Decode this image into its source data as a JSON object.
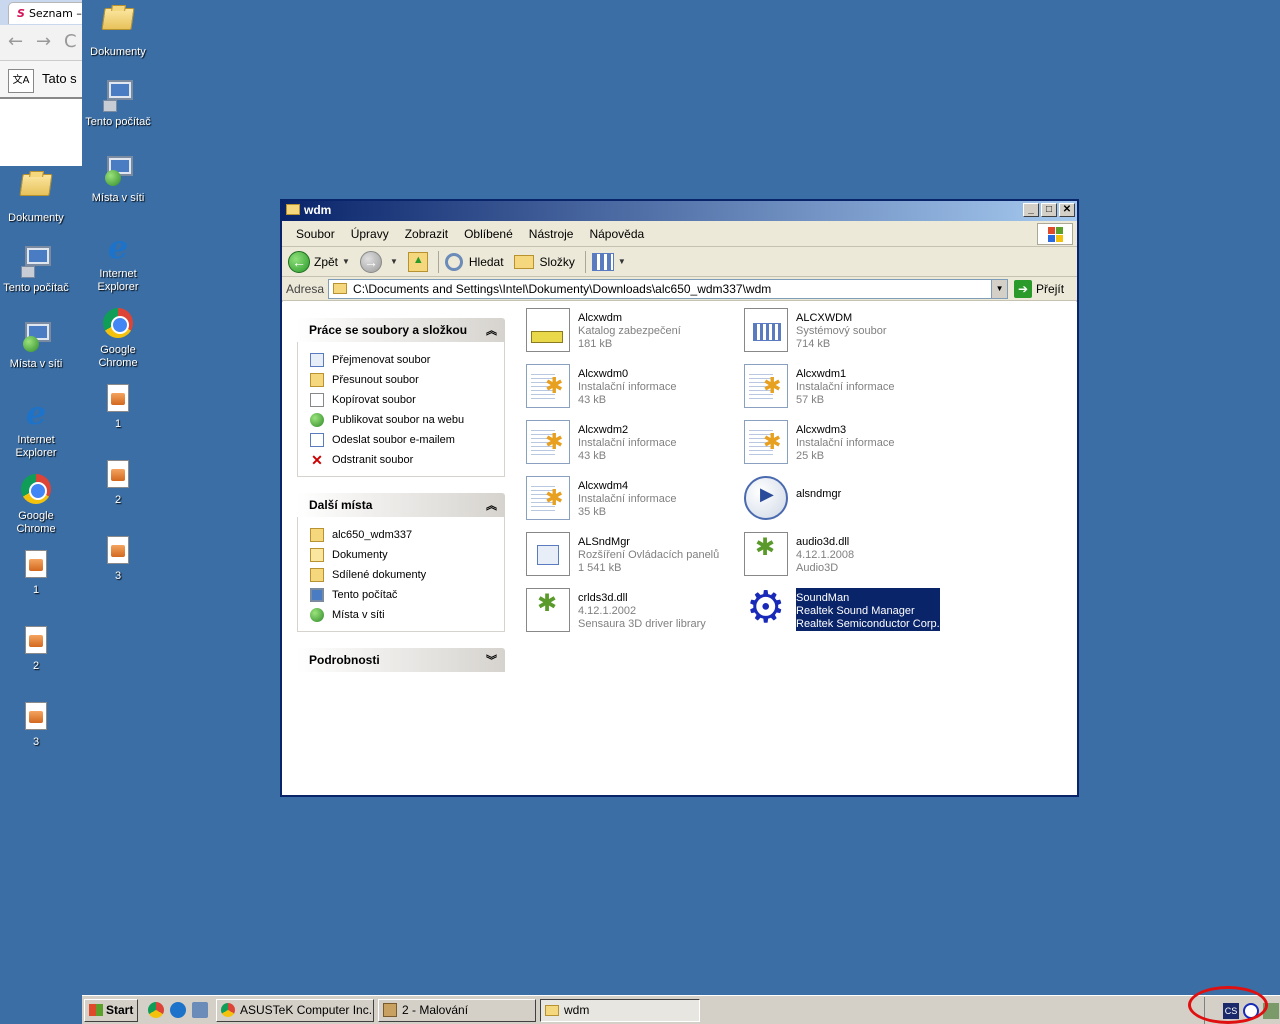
{
  "browser": {
    "tab_title": "Seznam –",
    "translate_text": "Tato s"
  },
  "desktop_icons_col1": [
    {
      "label": "Dokumenty",
      "icon": "folder-docs-icon"
    },
    {
      "label": "Tento počítač",
      "icon": "my-computer-icon"
    },
    {
      "label": "Místa v síti",
      "icon": "network-icon"
    },
    {
      "label": "Internet Explorer",
      "icon": "ie-icon"
    },
    {
      "label": "Google Chrome",
      "icon": "chrome-icon"
    },
    {
      "label": "1",
      "icon": "image-file-icon"
    },
    {
      "label": "2",
      "icon": "image-file-icon"
    },
    {
      "label": "3",
      "icon": "image-file-icon"
    }
  ],
  "desktop_icons_col2": [
    {
      "label": "Dokumenty",
      "icon": "folder-docs-icon"
    },
    {
      "label": "Tento počítač",
      "icon": "my-computer-icon"
    },
    {
      "label": "Místa v síti",
      "icon": "network-icon"
    },
    {
      "label": "Internet Explorer",
      "icon": "ie-icon"
    },
    {
      "label": "Google Chrome",
      "icon": "chrome-icon"
    },
    {
      "label": "1",
      "icon": "image-file-icon"
    },
    {
      "label": "2",
      "icon": "image-file-icon"
    },
    {
      "label": "3",
      "icon": "image-file-icon"
    }
  ],
  "window": {
    "title": "wdm",
    "menu": [
      "Soubor",
      "Úpravy",
      "Zobrazit",
      "Oblíbené",
      "Nástroje",
      "Nápověda"
    ],
    "toolbar": {
      "back": "Zpět",
      "search": "Hledat",
      "folders": "Složky"
    },
    "address": {
      "label": "Adresa",
      "path": "C:\\Documents and Settings\\Intel\\Dokumenty\\Downloads\\alc650_wdm337\\wdm",
      "go": "Přejít"
    }
  },
  "taskpane": {
    "file_tasks": {
      "title": "Práce se soubory a složkou",
      "items": [
        "Přejmenovat soubor",
        "Přesunout soubor",
        "Kopírovat soubor",
        "Publikovat soubor na webu",
        "Odeslat soubor e-mailem",
        "Odstranit soubor"
      ]
    },
    "other_places": {
      "title": "Další místa",
      "items": [
        "alc650_wdm337",
        "Dokumenty",
        "Sdílené dokumenty",
        "Tento počítač",
        "Místa v síti"
      ]
    },
    "details": {
      "title": "Podrobnosti"
    }
  },
  "files": [
    {
      "name": "Alcxwdm",
      "line2": "Katalog zabezpečení",
      "line3": "181 kB",
      "icon": "security-catalog-icon"
    },
    {
      "name": "ALCXWDM",
      "line2": "Systémový soubor",
      "line3": "714 kB",
      "icon": "system-file-icon"
    },
    {
      "name": "Alcxwdm0",
      "line2": "Instalační informace",
      "line3": "43 kB",
      "icon": "setup-info-icon"
    },
    {
      "name": "Alcxwdm1",
      "line2": "Instalační informace",
      "line3": "57 kB",
      "icon": "setup-info-icon"
    },
    {
      "name": "Alcxwdm2",
      "line2": "Instalační informace",
      "line3": "43 kB",
      "icon": "setup-info-icon"
    },
    {
      "name": "Alcxwdm3",
      "line2": "Instalační informace",
      "line3": "25 kB",
      "icon": "setup-info-icon"
    },
    {
      "name": "Alcxwdm4",
      "line2": "Instalační informace",
      "line3": "35 kB",
      "icon": "setup-info-icon"
    },
    {
      "name": "alsndmgr",
      "line2": "",
      "line3": "",
      "icon": "media-player-icon"
    },
    {
      "name": "ALSndMgr",
      "line2": "Rozšíření Ovládacích panelů",
      "line3": "1 541 kB",
      "icon": "control-panel-icon"
    },
    {
      "name": "audio3d.dll",
      "line2": "4.12.1.2008",
      "line3": "Audio3D",
      "icon": "dll-icon"
    },
    {
      "name": "crlds3d.dll",
      "line2": "4.12.1.2002",
      "line3": "Sensaura 3D driver library",
      "icon": "dll-icon"
    },
    {
      "name": "SoundMan",
      "line2": "Realtek Sound Manager",
      "line3": "Realtek Semiconductor Corp.",
      "icon": "realtek-crab-icon",
      "selected": true
    }
  ],
  "taskbar": {
    "start": "Start",
    "tasks": [
      {
        "label": "ASUSTeK Computer Inc. ...",
        "icon": "chrome-icon"
      },
      {
        "label": "2 - Malování",
        "icon": "paint-icon"
      },
      {
        "label": "wdm",
        "icon": "folder-icon",
        "active": true
      }
    ],
    "tray": {
      "ime": "CS"
    }
  }
}
